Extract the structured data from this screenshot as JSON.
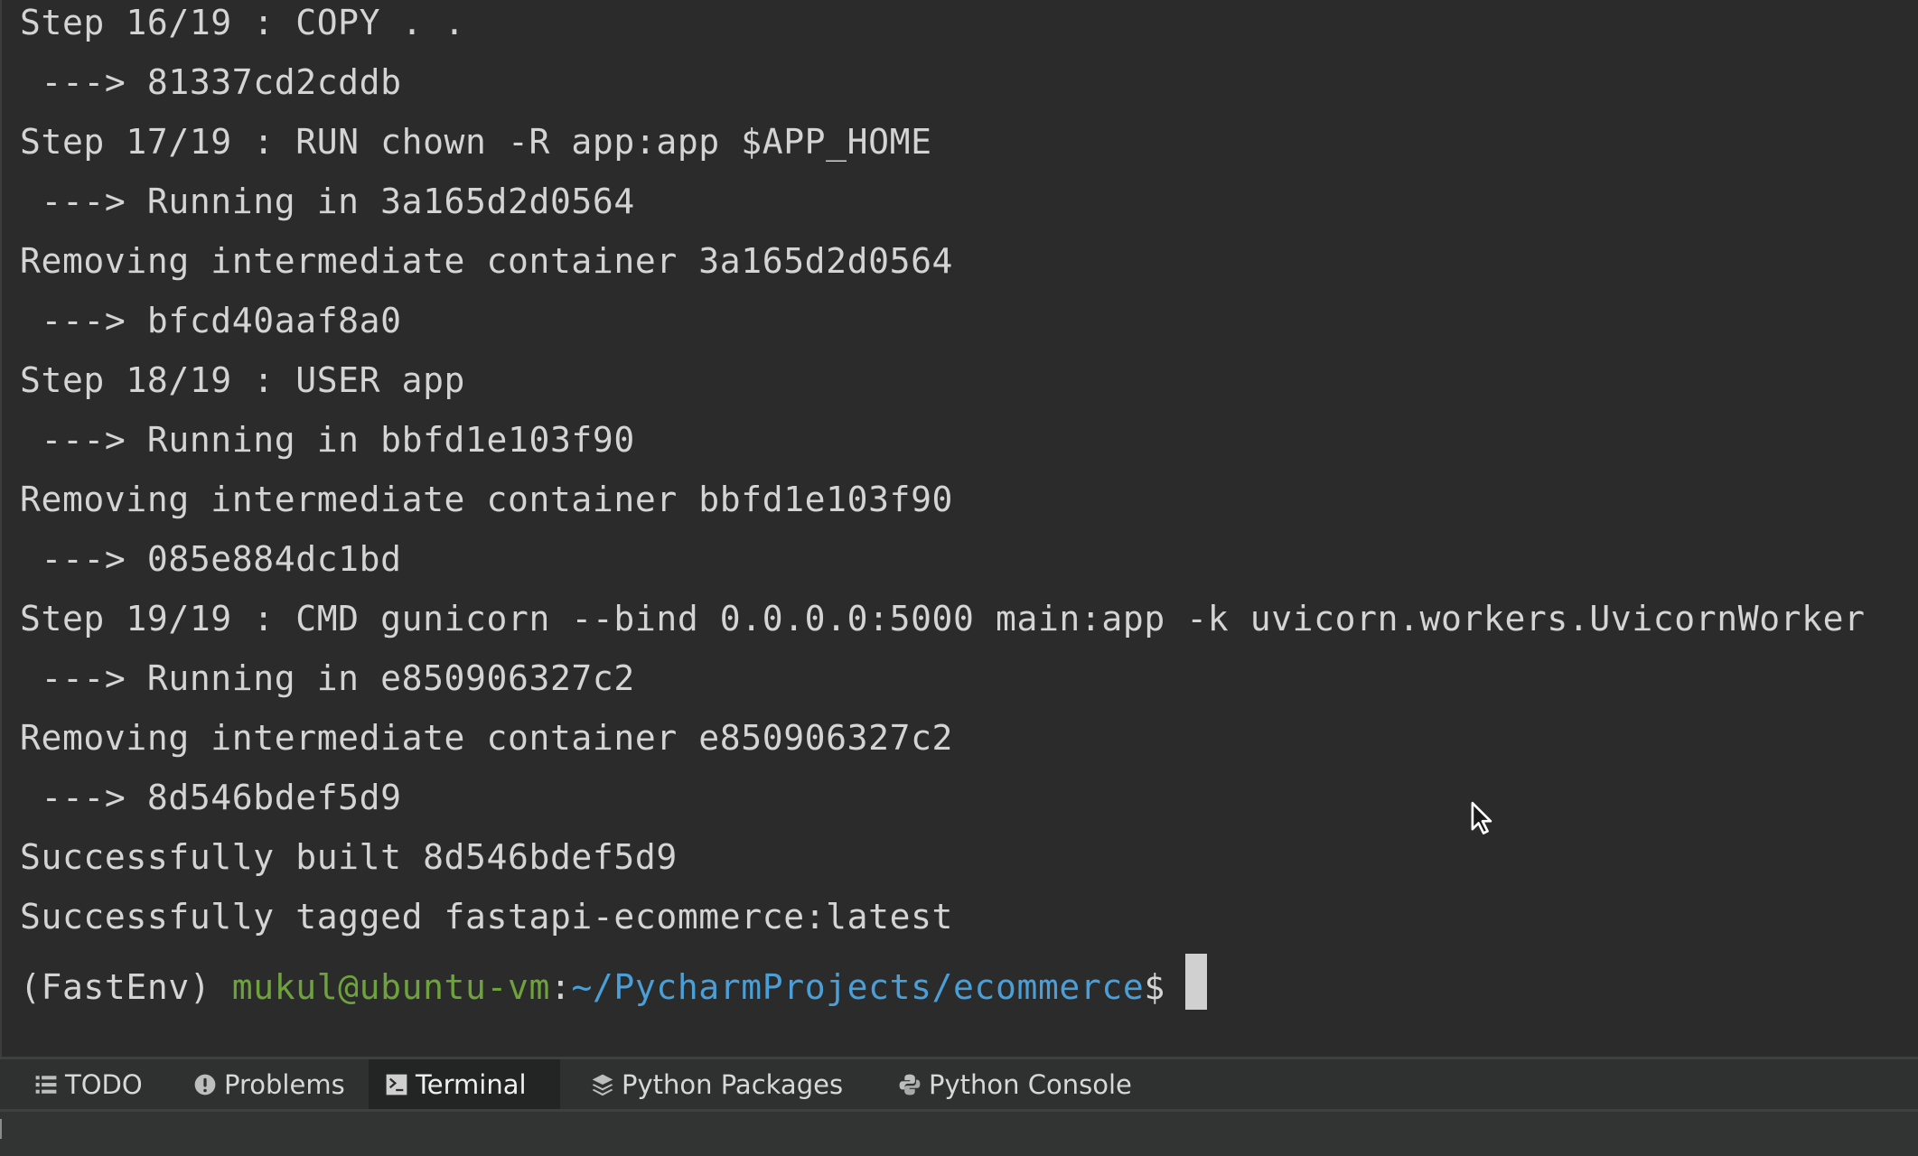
{
  "terminal": {
    "lines": [
      "Step 16/19 : COPY . .",
      " ---> 81337cd2cddb",
      "Step 17/19 : RUN chown -R app:app $APP_HOME",
      " ---> Running in 3a165d2d0564",
      "Removing intermediate container 3a165d2d0564",
      " ---> bfcd40aaf8a0",
      "Step 18/19 : USER app",
      " ---> Running in bbfd1e103f90",
      "Removing intermediate container bbfd1e103f90",
      " ---> 085e884dc1bd",
      "Step 19/19 : CMD gunicorn --bind 0.0.0.0:5000 main:app -k uvicorn.workers.UvicornWorker",
      " ---> Running in e850906327c2",
      "Removing intermediate container e850906327c2",
      " ---> 8d546bdef5d9",
      "Successfully built 8d546bdef5d9",
      "Successfully tagged fastapi-ecommerce:latest"
    ],
    "prompt": {
      "env": "(FastEnv) ",
      "user_host": "mukul@ubuntu-vm",
      "colon": ":",
      "path": "~/PycharmProjects/ecommerce",
      "dollar": "$"
    },
    "colors": {
      "background": "#2b2b2b",
      "text": "#d4d4d4",
      "user_host": "#6ea33c",
      "path": "#4a9fd8"
    }
  },
  "tool_tabs": [
    {
      "label": "TODO",
      "icon": "list-icon",
      "active": false
    },
    {
      "label": "Problems",
      "icon": "exclamation-circle-icon",
      "active": false
    },
    {
      "label": "Terminal",
      "icon": "terminal-icon",
      "active": true
    },
    {
      "label": "Python Packages",
      "icon": "layers-icon",
      "active": false
    },
    {
      "label": "Python Console",
      "icon": "python-icon",
      "active": false
    }
  ]
}
